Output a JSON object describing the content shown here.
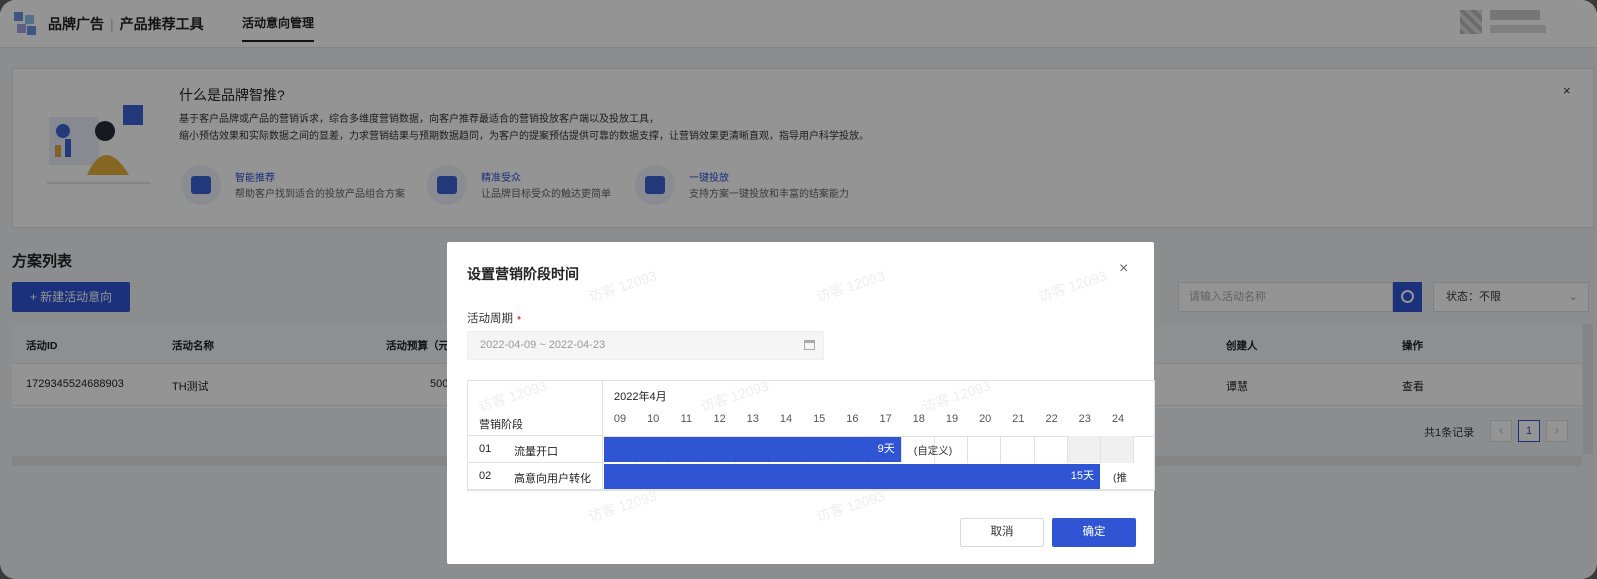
{
  "header": {
    "brand": "品牌广告",
    "product": "产品推荐工具",
    "nav_tab": "活动意向管理"
  },
  "intro": {
    "title": "什么是品牌智推?",
    "desc_line1": "基于客户品牌或产品的营销诉求，综合多维度营销数据，向客户推荐最适合的营销投放客户端以及投放工具，",
    "desc_line2": "缩小预估效果和实际数据之间的显差，力求营销结果与预期数据趋同，为客户的提案预估提供可靠的数据支撑，让营销效果更清晰直观，指导用户科学投放。",
    "close": "×",
    "features": [
      {
        "title": "智能推荐",
        "desc": "帮助客户找到适合的投放产品组合方案"
      },
      {
        "title": "精准受众",
        "desc": "让品牌目标受众的触达更简单"
      },
      {
        "title": "一键投放",
        "desc": "支持方案一键投放和丰富的结案能力"
      }
    ]
  },
  "list": {
    "title": "方案列表",
    "new_button": "+  新建活动意向",
    "search_placeholder": "请输入活动名称",
    "status_label": "状态：不限",
    "columns": [
      "活动ID",
      "活动名称",
      "活动预算（元",
      "创建人",
      "操作"
    ],
    "rows": [
      {
        "id": "1729345524688903",
        "name": "TH测试",
        "budget": "500",
        "creator": "谭慧",
        "action": "查看"
      }
    ],
    "total": "共1条记录",
    "page": "1",
    "prev": "‹",
    "next": "›"
  },
  "modal": {
    "title": "设置营销阶段时间",
    "close": "×",
    "watermark": "访客 12093",
    "period_label": "活动周期",
    "required_mark": "•",
    "date_range": "2022-04-09 ~ 2022-04-23",
    "gantt": {
      "month": "2022年4月",
      "stage_header": "营销阶段",
      "days": [
        "09",
        "10",
        "11",
        "12",
        "13",
        "14",
        "15",
        "16",
        "17",
        "18",
        "19",
        "20",
        "21",
        "22",
        "23",
        "24"
      ],
      "stages": [
        {
          "no": "01",
          "name": "流量开口",
          "duration": "9天",
          "extra": "(自定义)",
          "start_day": 0,
          "span_days": 9
        },
        {
          "no": "02",
          "name": "高意向用户转化",
          "duration": "15天",
          "extra": "(推",
          "start_day": 0,
          "span_days": 15
        }
      ]
    },
    "cancel": "取消",
    "ok": "确定"
  }
}
